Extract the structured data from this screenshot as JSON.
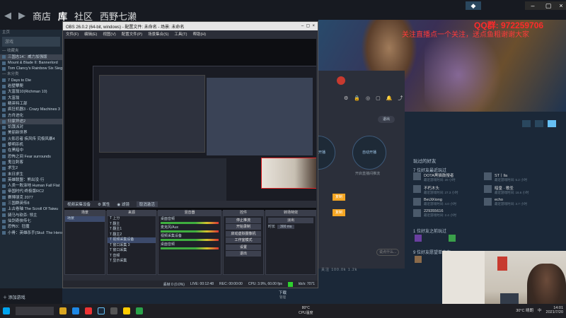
{
  "steam": {
    "nav": [
      "商店",
      "库",
      "社区",
      "西野七濑"
    ],
    "side_search": "游戏",
    "side_home": "主页",
    "side_items": [
      {
        "label": "— 收藏夹",
        "kind": "hdr"
      },
      {
        "label": "三国志14：威力加强版",
        "kind": "hl"
      },
      {
        "label": "Mount & Blade II: Bannerlord",
        "kind": ""
      },
      {
        "label": "Tom Clancy's Rainbow Six Siege",
        "kind": ""
      },
      {
        "label": "— 未分类",
        "kind": "hdr"
      },
      {
        "label": "7 Days to Die",
        "kind": ""
      },
      {
        "label": "岩壁攀爬",
        "kind": ""
      },
      {
        "label": "大富翁10(Richman 10)",
        "kind": ""
      },
      {
        "label": "大富翁",
        "kind": ""
      },
      {
        "label": "精英特工部",
        "kind": ""
      },
      {
        "label": "疯狂机器3 - Crazy Machines 3",
        "kind": ""
      },
      {
        "label": "方舟进化",
        "kind": ""
      },
      {
        "label": "归家异途2",
        "kind": "hl"
      },
      {
        "label": "饥饿派对",
        "kind": ""
      },
      {
        "label": "美丽新世界",
        "kind": ""
      },
      {
        "label": "火影忍者 疾风传 究极风暴4",
        "kind": ""
      },
      {
        "label": "黎明杀机",
        "kind": ""
      },
      {
        "label": "在黑暗中",
        "kind": ""
      },
      {
        "label": "恐怖之间 Fear surrounds",
        "kind": ""
      },
      {
        "label": "鬼泣刺客",
        "kind": ""
      },
      {
        "label": "求生2",
        "kind": ""
      },
      {
        "label": "末日求生",
        "kind": ""
      },
      {
        "label": "英雄联盟：熊出没·行",
        "kind": ""
      },
      {
        "label": "人类一败涂地 Human Fall Flat",
        "kind": ""
      },
      {
        "label": "帝国时代:终极版RC2",
        "kind": ""
      },
      {
        "label": "赛博朋克 2077",
        "kind": ""
      },
      {
        "label": "三国群英传8",
        "kind": ""
      },
      {
        "label": "上古卷轴 The Scroll Of Taiwu",
        "kind": ""
      },
      {
        "label": "骑马与砍杀: 领主",
        "kind": ""
      },
      {
        "label": "仙剑奇侠传七",
        "kind": ""
      },
      {
        "label": "恐怖3：狂魔",
        "kind": ""
      },
      {
        "label": "小骨：英雄杀手(Skul: The Hero Slayer)",
        "kind": ""
      }
    ],
    "add_game": "添加游戏",
    "downloads": "下载",
    "downloads_sub": "管理",
    "qq": "QQ群: 972259706",
    "ad": "关注直播点一个关注，送点鱼粗谢谢大家",
    "panel": {
      "exit": "退出",
      "circle_left": "一键开播",
      "circle_right": "自动开播",
      "sub_left": "开启直播间",
      "sub_right": "开启直播间推流",
      "orange1": "复制",
      "orange2": "复制",
      "chat": "说点什么...",
      "counts": [
        "关注",
        "100.0k",
        "1.2k"
      ]
    },
    "friends": {
      "section_title": "玩过的好友",
      "sect1": "7 位好友最近玩过",
      "sect2": "1 位好友之前玩过",
      "sect3": "9 位好友愿望单中有",
      "list": [
        {
          "name": "DOTA黑猫鼓搜者",
          "status": "最近游戏时间: 20 小时"
        },
        {
          "name": "不朽木头",
          "status": "最近游戏时间: 27.3 小时"
        },
        {
          "name": "BeiJiXiong",
          "status": "最近游戏时间: 4.0 小时"
        },
        {
          "name": "229355616",
          "status": "最近游戏时间: 2.4 小时"
        },
        {
          "name": "ST丨lla",
          "status": "最近游戏时间: 5.2 小时"
        },
        {
          "name": "暗皇 · 歌圣",
          "status": "最近游戏时间: 16.6 小时"
        },
        {
          "name": "echo",
          "status": "最近游戏时间: 3.7 小时"
        }
      ]
    }
  },
  "obs": {
    "title": "OBS 26.0.2 (64-bit, windows) - 配置文件: 未命名 - 场景: 未命名",
    "menu": [
      "文件(F)",
      "编辑(E)",
      "视图(V)",
      "配置文件(P)",
      "场景集合(S)",
      "工具(T)",
      "帮助(H)"
    ],
    "topbar": [
      "视频采集设备",
      "属性",
      "滤镜",
      "取消激活"
    ],
    "dock_titles": [
      "场景",
      "来源",
      "混音器",
      "控件",
      "转场特效"
    ],
    "scenes": [
      "场景"
    ],
    "sources": [
      "上分",
      "翻主",
      "翻主1",
      "翻主2",
      "视频采集设备",
      "窗口采集 3",
      "窗口采集",
      "音频",
      "显示采集"
    ],
    "mixer": [
      "桌面音频",
      "麦克风/Aux",
      "视频采集设备",
      "桌面音频"
    ],
    "controls": [
      "停止推流",
      "开始录制",
      "启动虚拟摄像机",
      "工作室模式",
      "设置",
      "退出"
    ],
    "transition": {
      "type": "淡出",
      "duration_label": "时长",
      "duration": "300 ms"
    },
    "status": [
      "丢帧 0 (0.0%)",
      "LIVE: 00:12:48",
      "REC: 00:00:00",
      "CPU: 3.9%, 60.00 fps",
      "kb/s: 7071"
    ]
  },
  "taskbar": {
    "cpu_temp": "80°C",
    "cpu_label": "CPU温度",
    "weather": "30°C 晴朗",
    "time": "14:01",
    "date": "2021/7/20",
    "lang": "中"
  },
  "colors": {
    "steam_bg": "#1b2838",
    "obs_bg": "#2b2e38",
    "accent_red": "#e02424",
    "steam_blue": "#66c0f4"
  }
}
